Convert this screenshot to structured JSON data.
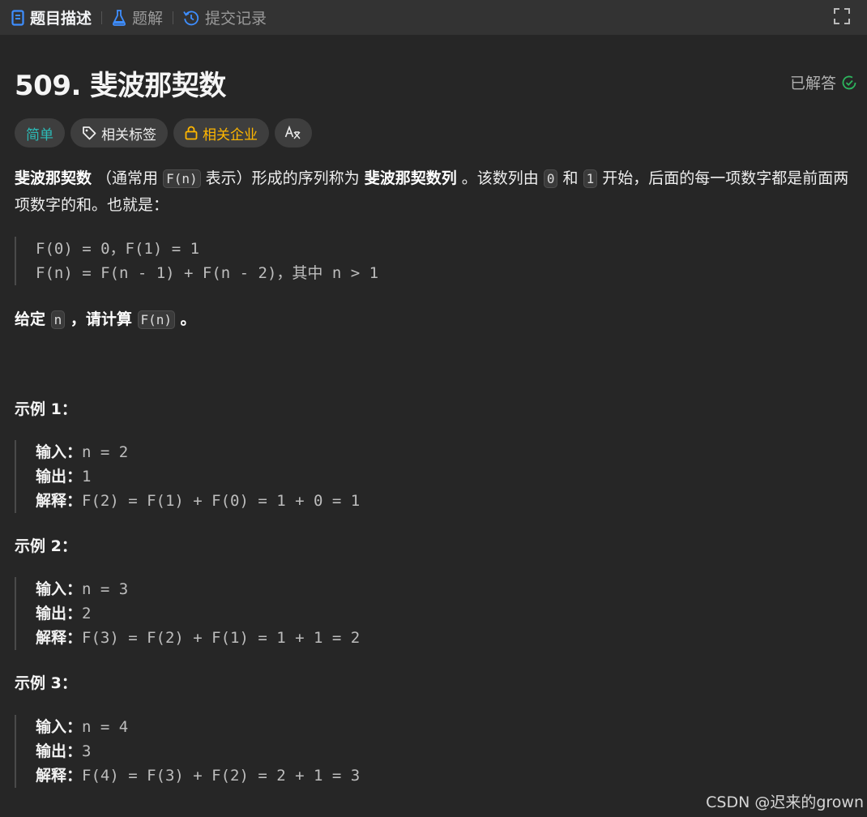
{
  "tabs": [
    {
      "label": "题目描述",
      "icon": "document-icon",
      "active": true
    },
    {
      "label": "题解",
      "icon": "flask-icon",
      "active": false
    },
    {
      "label": "提交记录",
      "icon": "history-icon",
      "active": false
    }
  ],
  "problem": {
    "title": "509. 斐波那契数",
    "status": "已解答",
    "tags": {
      "difficulty": "简单",
      "related_tags": "相关标签",
      "companies": "相关企业",
      "font": "A"
    },
    "desc": {
      "t1": "斐波那契数",
      "t2": " （通常用 ",
      "c1": "F(n)",
      "t3": " 表示）形成的序列称为 ",
      "t4": "斐波那契数列",
      "t5": " 。该数列由 ",
      "c2": "0",
      "t6": " 和 ",
      "c3": "1",
      "t7": " 开始，后面的每一项数字都是前面两项数字的和。也就是：",
      "formula1": "F(0) = 0，F(1) = 1",
      "formula2": "F(n) = F(n - 1) + F(n - 2)，其中 n > 1",
      "g1": "给定 ",
      "c4": "n",
      "g2": " ，请计算 ",
      "c5": "F(n)",
      "g3": " 。"
    }
  },
  "labels": {
    "input": "输入：",
    "output": "输出：",
    "explain": "解释："
  },
  "examples": [
    {
      "title": "示例 1：",
      "input": "n = 2",
      "output": "1",
      "explain": "F(2) = F(1) + F(0) = 1 + 0 = 1"
    },
    {
      "title": "示例 2：",
      "input": "n = 3",
      "output": "2",
      "explain": "F(3) = F(2) + F(1) = 1 + 1 = 2"
    },
    {
      "title": "示例 3：",
      "input": "n = 4",
      "output": "3",
      "explain": "F(4) = F(3) + F(2) = 2 + 1 = 3"
    }
  ],
  "watermark": "CSDN @迟来的grown",
  "colors": {
    "easy": "#2cbbb7",
    "company": "#ffb700",
    "solved": "#2db55d",
    "tab_icon": "#3e8eff"
  }
}
